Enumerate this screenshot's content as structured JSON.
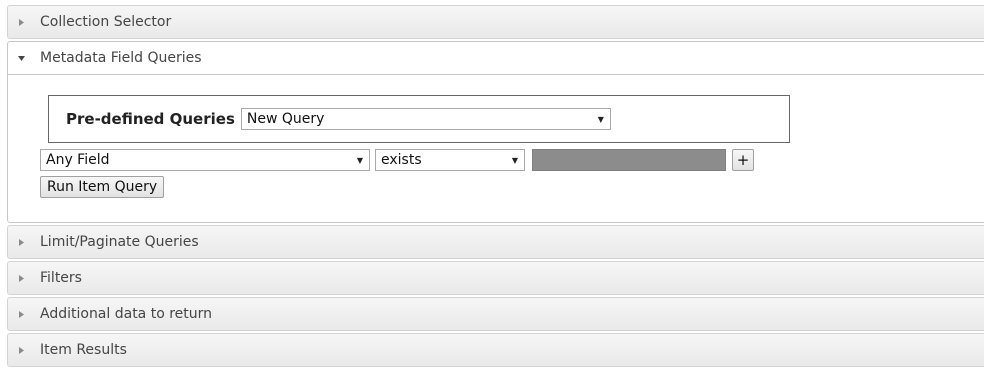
{
  "sections": {
    "collection_selector": {
      "label": "Collection Selector"
    },
    "metadata_field_queries": {
      "label": "Metadata Field Queries"
    },
    "limit_paginate": {
      "label": "Limit/Paginate Queries"
    },
    "filters": {
      "label": "Filters"
    },
    "additional_data": {
      "label": "Additional data to return"
    },
    "item_results": {
      "label": "Item Results"
    }
  },
  "query": {
    "predefined_label": "Pre-defined Queries",
    "predefined_value": "New Query",
    "field_value": "Any Field",
    "operator_value": "exists",
    "add_label": "+",
    "run_label": "Run Item Query"
  },
  "icons": {
    "collapsed": "triangle-right-icon",
    "expanded": "triangle-down-icon",
    "dropdown": "triangle-down-caret-icon"
  },
  "colors": {
    "header_bg": "#ececec",
    "border": "#d3d3d3",
    "value_field_fill": "#8c8c8c"
  }
}
